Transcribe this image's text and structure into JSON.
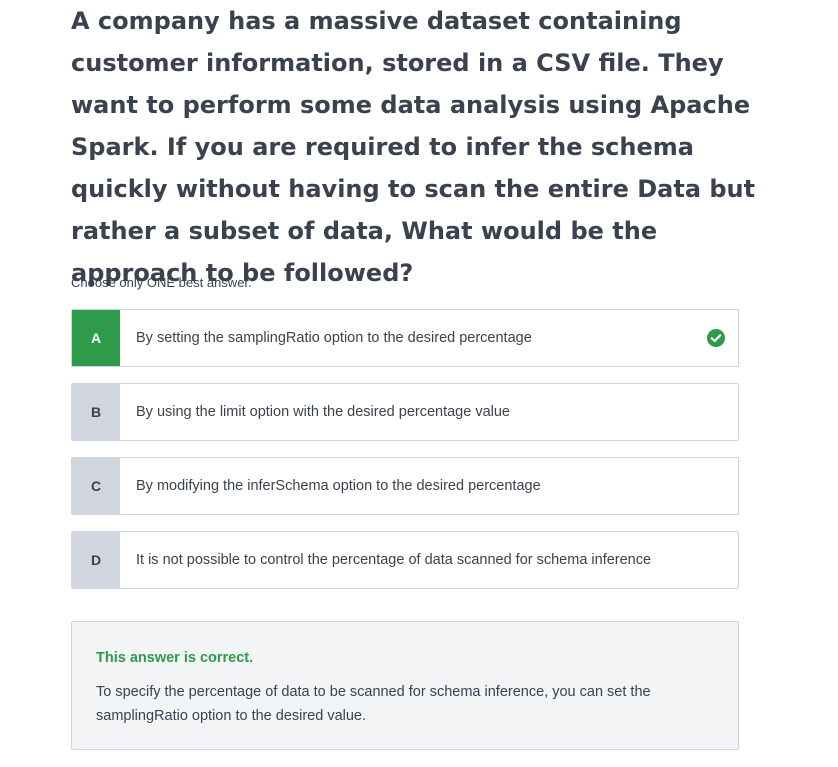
{
  "question": {
    "text": "A company has a massive dataset containing customer information, stored in a CSV file. They want to perform some data analysis using Apache Spark. If you are required to infer the schema quickly without having to scan the entire Data but rather a subset of data, What would be the approach to be followed?"
  },
  "instruction": "Choose only ONE best answer.",
  "options": [
    {
      "letter": "A",
      "text": "By setting the samplingRatio option to the desired percentage",
      "selected": true,
      "correct": true
    },
    {
      "letter": "B",
      "text": "By using the limit option with the desired percentage value",
      "selected": false
    },
    {
      "letter": "C",
      "text": "By modifying the inferSchema option to the desired percentage",
      "selected": false
    },
    {
      "letter": "D",
      "text": "It is not possible to control the percentage of data scanned for schema inference",
      "selected": false
    }
  ],
  "feedback": {
    "status": "This answer is correct.",
    "explanation": "To specify the percentage of data to be scanned for schema inference, you can set the samplingRatio option to the desired value."
  },
  "colors": {
    "correct_green": "#2e9b4a",
    "letter_bg": "#d1d6e0",
    "text": "#39424e",
    "feedback_bg": "#f2f4f6",
    "border": "#d1d5de"
  },
  "icons": {
    "correct_mark": "check-circle-icon"
  }
}
